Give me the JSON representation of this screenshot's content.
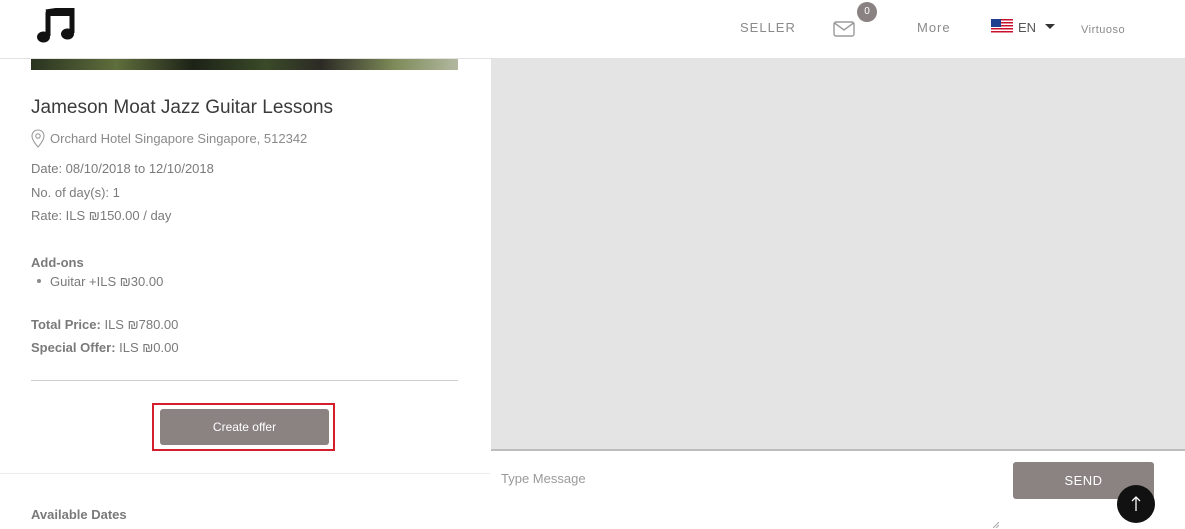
{
  "header": {
    "nav_seller": "SELLER",
    "mail_count": "0",
    "nav_more": "More",
    "language": "EN",
    "user_name": "Virtuoso"
  },
  "gig": {
    "title": "Jameson Moat Jazz Guitar Lessons",
    "location": "Orchard Hotel Singapore Singapore, 512342",
    "date": "Date: 08/10/2018 to 12/10/2018",
    "days": "No. of day(s): 1",
    "rate": "Rate: ILS ₪150.00 / day",
    "addons_title": "Add-ons",
    "addons": [
      "Guitar +ILS ₪30.00"
    ],
    "total_price_label": "Total Price:",
    "total_price_value": " ILS ₪780.00",
    "special_offer_label": "Special Offer:",
    "special_offer_value": " ILS ₪0.00",
    "create_offer_label": "Create offer",
    "available_dates_title": "Available Dates"
  },
  "chat": {
    "message_placeholder": "Type Message",
    "send_label": "SEND"
  },
  "icons": {
    "logo": "music-note-icon",
    "mail": "mail-icon",
    "flag": "us-flag-icon",
    "location": "map-pin-icon",
    "scroll_top": "arrow-up-icon"
  },
  "colors": {
    "button": "#8b8282",
    "highlight_outline": "#d41f2a",
    "chat_background": "#e4e4e4"
  }
}
